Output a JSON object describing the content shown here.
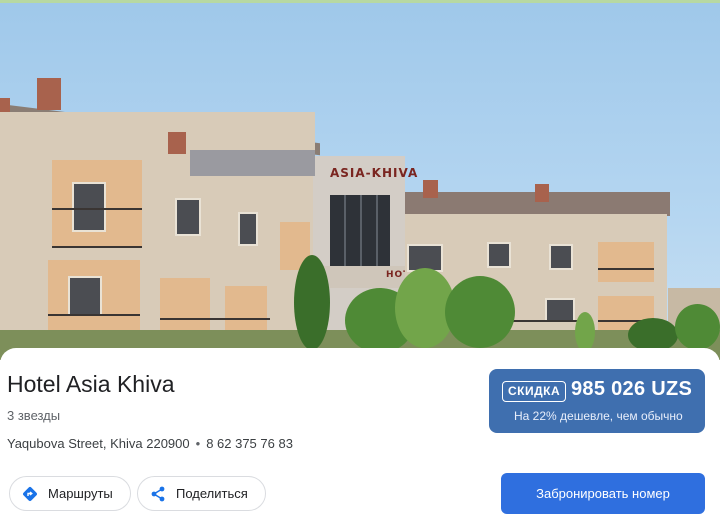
{
  "photo": {
    "sign_text": "ASIA-KHIVA",
    "sign_lower": "HOTEL"
  },
  "hotel": {
    "name": "Hotel Asia Khiva",
    "stars_text": "3 звезды",
    "address": "Yaqubova Street, Khiva 220900",
    "phone": "8 62 375 76 83"
  },
  "deal": {
    "badge": "СКИДКА",
    "price": "985 026 UZS",
    "note": "На 22% дешевле, чем обычно",
    "color": "#3f6faf"
  },
  "actions": {
    "routes_label": "Маршруты",
    "routes_icon": "directions-icon",
    "share_label": "Поделиться",
    "share_icon": "share-icon",
    "book_label": "Забронировать номер",
    "book_color": "#2f6fdf"
  }
}
